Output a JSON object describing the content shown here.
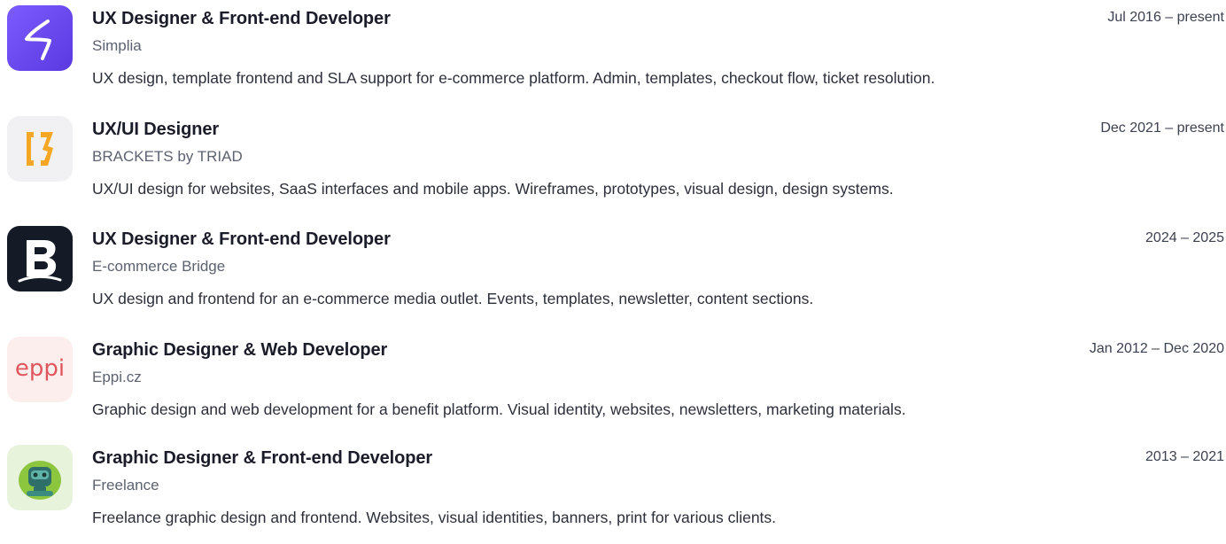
{
  "experience": [
    {
      "logo_icon": "simplia-logo-icon",
      "title": "UX Designer & Front-end Developer",
      "company": "Simplia",
      "dates": "Jul 2016 – present",
      "description": "UX design, template frontend and SLA support for e-commerce platform. Admin, templates, checkout flow, ticket resolution."
    },
    {
      "logo_icon": "brackets-logo-icon",
      "title": "UX/UI Designer",
      "company": "BRACKETS by TRIAD",
      "dates": "Dec 2021 – present",
      "description": "UX/UI design for websites, SaaS interfaces and mobile apps. Wireframes, prototypes, visual design, design systems."
    },
    {
      "logo_icon": "ecommerce-bridge-logo-icon",
      "title": "UX Designer & Front-end Developer",
      "company": "E-commerce Bridge",
      "dates": "2024 – 2025",
      "description": "UX design and frontend for an e-commerce media outlet. Events, templates, newsletter, content sections."
    },
    {
      "logo_icon": "eppi-logo-icon",
      "logo_text": "eppi",
      "title": "Graphic Designer & Web Developer",
      "company": "Eppi.cz",
      "dates": "Jan 2012 – Dec 2020",
      "description": "Graphic design and web development for a benefit platform. Visual identity, websites, newsletters, marketing materials."
    },
    {
      "logo_icon": "freelance-robot-logo-icon",
      "title": "Graphic Designer & Front-end Developer",
      "company": "Freelance",
      "dates": "2013 – 2021",
      "description": "Freelance graphic design and frontend. Websites, visual identities, banners, print for various clients."
    }
  ],
  "colors": {
    "simplia": "#6a4cf5",
    "brackets_bg": "#f1f1f4",
    "brackets_accent": "#f5a623",
    "bridge_bg": "#141a26",
    "eppi_bg": "#fdeeee",
    "eppi_accent": "#e0565d",
    "freelance_bg": "#e8f3dc",
    "freelance_accent": "#8cc63f"
  }
}
